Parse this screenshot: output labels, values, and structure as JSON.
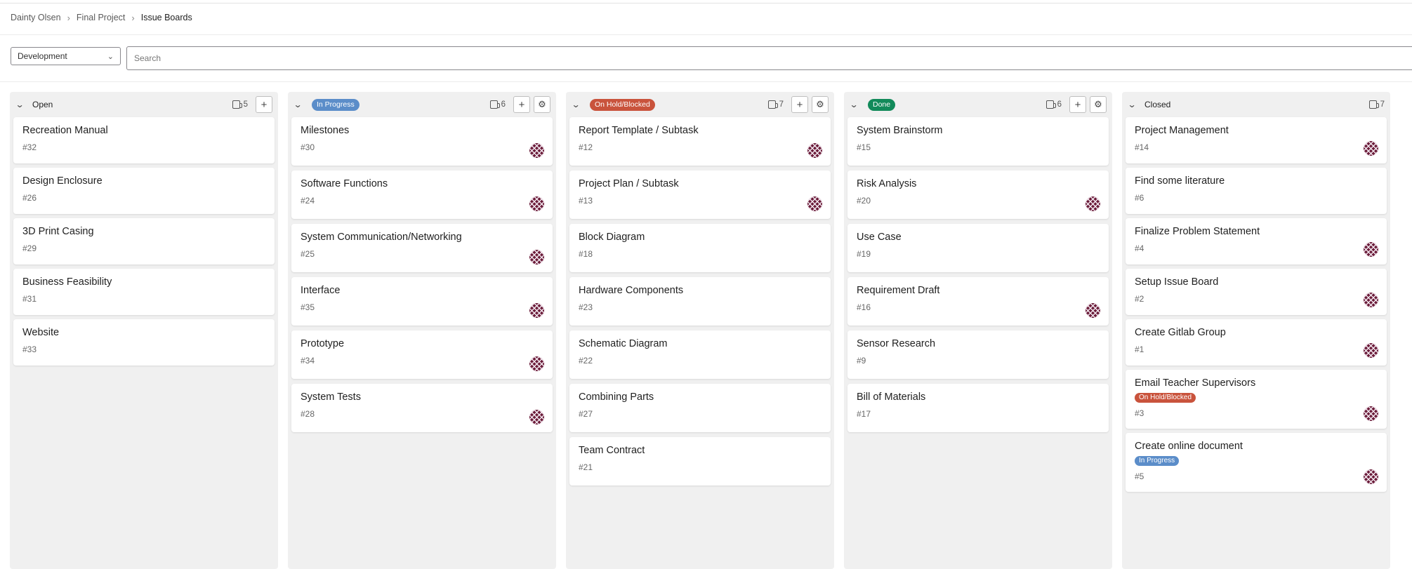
{
  "breadcrumb": [
    "Dainty Olsen",
    "Final Project",
    "Issue Boards"
  ],
  "filter": {
    "board_selected": "Development",
    "search_placeholder": "Search"
  },
  "colors": {
    "in_progress": "#5b8dc9",
    "on_hold": "#c9533c",
    "done": "#128a5a"
  },
  "lists": [
    {
      "title": "Open",
      "badge_color": "",
      "count": "5",
      "settings": false,
      "cards": [
        {
          "title": "Recreation Manual",
          "num": "#32",
          "avatar": false,
          "label": ""
        },
        {
          "title": "Design Enclosure",
          "num": "#26",
          "avatar": false,
          "label": ""
        },
        {
          "title": "3D Print Casing",
          "num": "#29",
          "avatar": false,
          "label": ""
        },
        {
          "title": "Business Feasibility",
          "num": "#31",
          "avatar": false,
          "label": ""
        },
        {
          "title": "Website",
          "num": "#33",
          "avatar": false,
          "label": ""
        }
      ]
    },
    {
      "title": "In Progress",
      "badge_color": "#5b8dc9",
      "count": "6",
      "settings": true,
      "cards": [
        {
          "title": "Milestones",
          "num": "#30",
          "avatar": true,
          "label": ""
        },
        {
          "title": "Software Functions",
          "num": "#24",
          "avatar": true,
          "label": ""
        },
        {
          "title": "System Communication/Networking",
          "num": "#25",
          "avatar": true,
          "label": ""
        },
        {
          "title": "Interface",
          "num": "#35",
          "avatar": true,
          "label": ""
        },
        {
          "title": "Prototype",
          "num": "#34",
          "avatar": true,
          "label": ""
        },
        {
          "title": "System Tests",
          "num": "#28",
          "avatar": true,
          "label": ""
        }
      ]
    },
    {
      "title": "On Hold/Blocked",
      "badge_color": "#c9533c",
      "count": "7",
      "settings": true,
      "cards": [
        {
          "title": "Report Template / Subtask",
          "num": "#12",
          "avatar": true,
          "label": ""
        },
        {
          "title": "Project Plan / Subtask",
          "num": "#13",
          "avatar": true,
          "label": ""
        },
        {
          "title": "Block Diagram",
          "num": "#18",
          "avatar": false,
          "label": ""
        },
        {
          "title": "Hardware Components",
          "num": "#23",
          "avatar": false,
          "label": ""
        },
        {
          "title": "Schematic Diagram",
          "num": "#22",
          "avatar": false,
          "label": ""
        },
        {
          "title": "Combining Parts",
          "num": "#27",
          "avatar": false,
          "label": ""
        },
        {
          "title": "Team Contract",
          "num": "#21",
          "avatar": false,
          "label": ""
        }
      ]
    },
    {
      "title": "Done",
      "badge_color": "#128a5a",
      "count": "6",
      "settings": true,
      "cards": [
        {
          "title": "System Brainstorm",
          "num": "#15",
          "avatar": false,
          "label": ""
        },
        {
          "title": "Risk Analysis",
          "num": "#20",
          "avatar": true,
          "label": ""
        },
        {
          "title": "Use Case",
          "num": "#19",
          "avatar": false,
          "label": ""
        },
        {
          "title": "Requirement Draft",
          "num": "#16",
          "avatar": true,
          "label": ""
        },
        {
          "title": "Sensor Research",
          "num": "#9",
          "avatar": false,
          "label": ""
        },
        {
          "title": "Bill of Materials",
          "num": "#17",
          "avatar": false,
          "label": ""
        }
      ]
    },
    {
      "title": "Closed",
      "badge_color": "",
      "count": "7",
      "settings": false,
      "cards": [
        {
          "title": "Project Management",
          "num": "#14",
          "avatar": true,
          "label": ""
        },
        {
          "title": "Find some literature",
          "num": "#6",
          "avatar": false,
          "label": ""
        },
        {
          "title": "Finalize Problem Statement",
          "num": "#4",
          "avatar": true,
          "label": ""
        },
        {
          "title": "Setup Issue Board",
          "num": "#2",
          "avatar": true,
          "label": ""
        },
        {
          "title": "Create Gitlab Group",
          "num": "#1",
          "avatar": true,
          "label": ""
        },
        {
          "title": "Email Teacher Supervisors",
          "num": "#3",
          "avatar": true,
          "label": "On Hold/Blocked",
          "label_color": "#c9533c"
        },
        {
          "title": "Create online document",
          "num": "#5",
          "avatar": true,
          "label": "In Progress",
          "label_color": "#5b8dc9"
        }
      ]
    }
  ]
}
